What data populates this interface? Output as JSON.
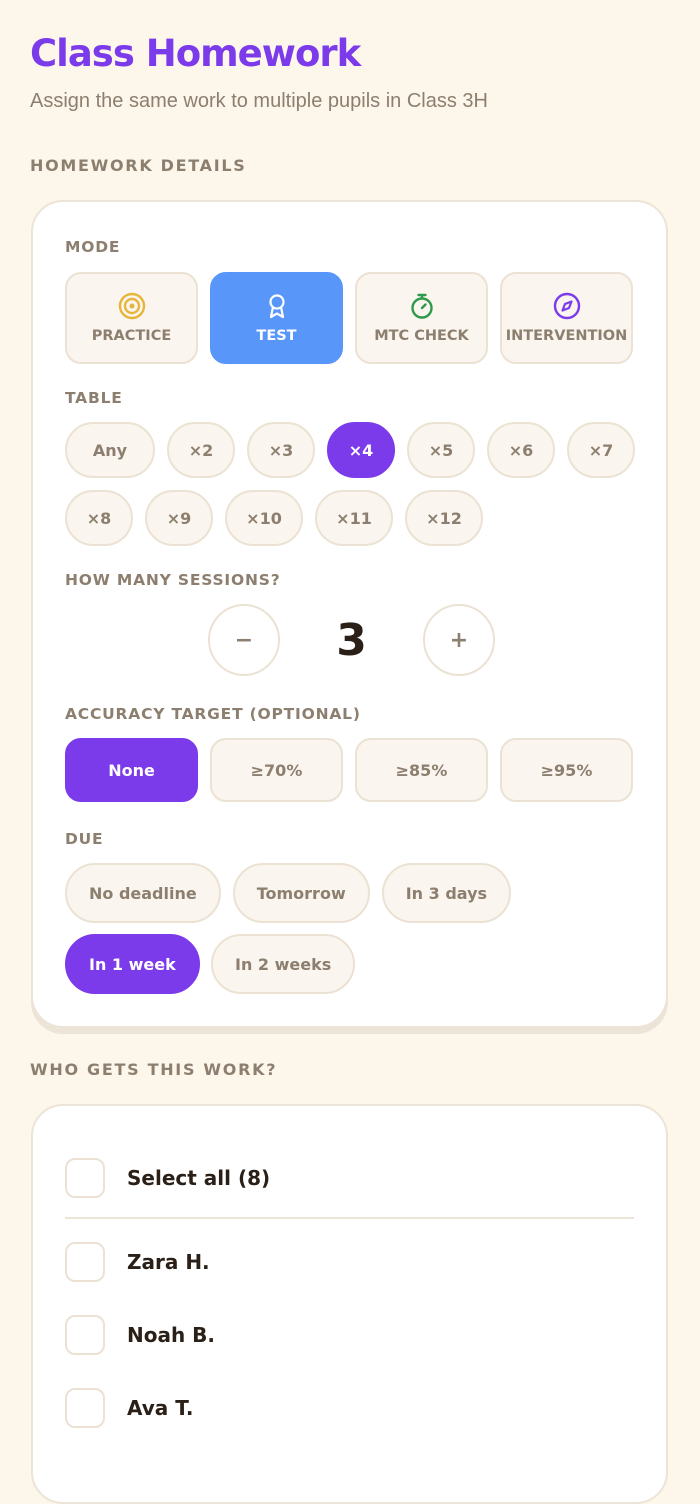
{
  "page": {
    "title": "Class Homework",
    "subtitle": "Assign the same work to multiple pupils in Class 3H"
  },
  "sections": {
    "details_heading": "HOMEWORK DETAILS",
    "who_heading": "WHO GETS THIS WORK?"
  },
  "mode": {
    "label": "MODE",
    "options": [
      {
        "label": "PRACTICE",
        "icon": "target-icon",
        "color": "#e6b53a",
        "selected": false
      },
      {
        "label": "TEST",
        "icon": "award-icon",
        "color": "#ffffff",
        "selected": true
      },
      {
        "label": "MTC CHECK",
        "icon": "stopwatch-icon",
        "color": "#2f9a4b",
        "selected": false
      },
      {
        "label": "INTERVENTION",
        "icon": "compass-icon",
        "color": "#7b3bea",
        "selected": false
      }
    ]
  },
  "table": {
    "label": "TABLE",
    "options": [
      "Any",
      "×2",
      "×3",
      "×4",
      "×5",
      "×6",
      "×7",
      "×8",
      "×9",
      "×10",
      "×11",
      "×12"
    ],
    "selected": "×4"
  },
  "sessions": {
    "label": "HOW MANY SESSIONS?",
    "decrement": "−",
    "value": "3",
    "increment": "+"
  },
  "accuracy": {
    "label": "ACCURACY TARGET (OPTIONAL)",
    "options": [
      "None",
      "≥70%",
      "≥85%",
      "≥95%"
    ],
    "selected": "None"
  },
  "due": {
    "label": "DUE",
    "options": [
      "No deadline",
      "Tomorrow",
      "In 3 days",
      "In 1 week",
      "In 2 weeks"
    ],
    "selected": "In 1 week"
  },
  "pupils": {
    "select_all": "Select all (8)",
    "names": [
      "Zara H.",
      "Noah B.",
      "Ava T."
    ]
  },
  "colors": {
    "accent": "#7b3bea",
    "test_blue": "#5896f9",
    "background": "#fdf6ea"
  }
}
